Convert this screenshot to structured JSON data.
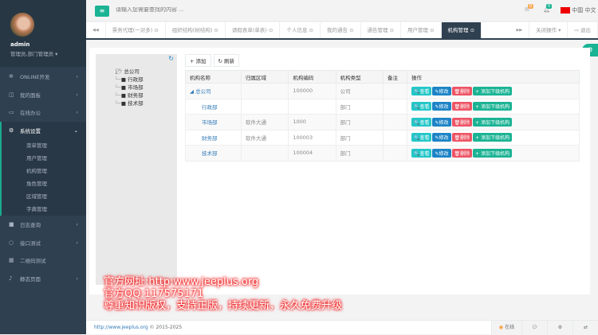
{
  "sidebar": {
    "user": "admin",
    "role": "管理员,部门管理员 ▾",
    "items": [
      {
        "label": "ONLINE开发",
        "icon": "✲"
      },
      {
        "label": "我的面板",
        "icon": "◫"
      },
      {
        "label": "在线办公",
        "icon": "▭"
      },
      {
        "label": "系统设置",
        "icon": "⚙"
      }
    ],
    "sub": [
      "菜单管理",
      "用户管理",
      "机构管理",
      "角色管理",
      "区域管理",
      "字典管理"
    ],
    "items2": [
      {
        "label": "日志查询",
        "icon": "■"
      },
      {
        "label": "接口测试",
        "icon": "○"
      },
      {
        "label": "二维码测试",
        "icon": "▦"
      },
      {
        "label": "静态页面",
        "icon": "♪"
      }
    ]
  },
  "top": {
    "search_placeholder": "请输入您需要查找的内容 …",
    "mail_count": "0",
    "bell_count": "0",
    "lang": "中国 中文"
  },
  "tabs": [
    "票务代理(一对多) ⊙",
    "组织结构(树结构) ⊙",
    "请假表单(单表) ⊙",
    "个人信息 ⊙",
    "我的通告 ⊙",
    "通告管理 ⊙",
    "用户管理 ⊙",
    "机构管理 ⊙"
  ],
  "tab_right": {
    "close_ops": "关闭操作 ▾",
    "logout": "⇨ 退出"
  },
  "tree": {
    "root": "总公司",
    "children": [
      "行政部",
      "市场部",
      "财务部",
      "技术部"
    ]
  },
  "toolbar": {
    "add": "+ 添加",
    "refresh": "↻ 刷新"
  },
  "table": {
    "headers": [
      "机构名称",
      "归属区域",
      "机构编码",
      "机构类型",
      "备注",
      "操作"
    ],
    "rows": [
      [
        "◢ 总公司",
        "",
        "100000",
        "公司",
        ""
      ],
      [
        "行政部",
        "",
        "",
        "部门",
        ""
      ],
      [
        "市场部",
        "软件大通",
        "1000",
        "部门",
        ""
      ],
      [
        "财务部",
        "软件大通",
        "100003",
        "部门",
        ""
      ],
      [
        "技术部",
        "",
        "100004",
        "部门",
        ""
      ]
    ],
    "actions": [
      "🔍查看",
      "✎修改",
      "🗑删除",
      "+ 添加下级机构"
    ]
  },
  "watermark": [
    "官方网址:http:www.jeeplus.org",
    "官方QQ:117575171",
    "尊重知识版权，支持正版，持续更新，永久免费升级"
  ],
  "footer": {
    "link": "http://www.jeeplus.org",
    "copy": " © 2015-2025",
    "online": "在线"
  }
}
